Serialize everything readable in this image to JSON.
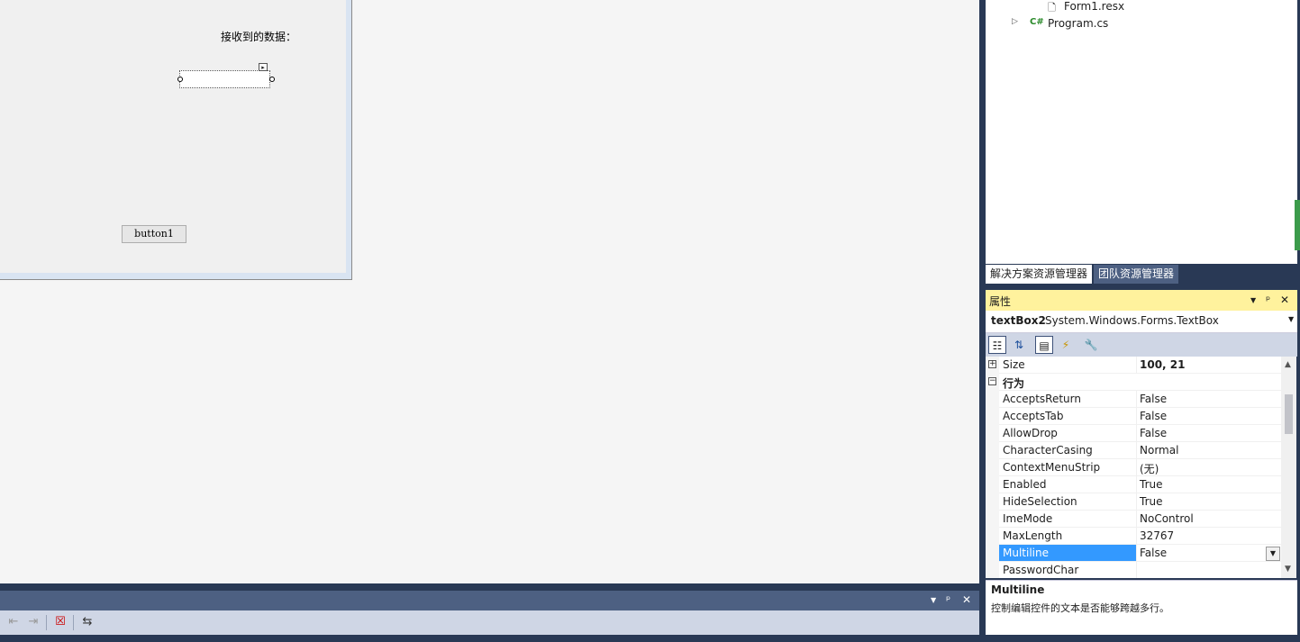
{
  "designer": {
    "label_text": "接收到的数据：",
    "button_text": "button1"
  },
  "solution_explorer": {
    "items": [
      {
        "name": "Form1.resx"
      },
      {
        "name": "Program.cs",
        "badge": "C#"
      }
    ],
    "tabs": [
      "解决方案资源管理器",
      "团队资源管理器"
    ]
  },
  "properties": {
    "title": "属性",
    "object_name": "textBox2",
    "object_type": "System.Windows.Forms.TextBox",
    "rows": [
      {
        "name": "Size",
        "value": "100, 21"
      },
      {
        "name": "行为",
        "value": ""
      },
      {
        "name": "AcceptsReturn",
        "value": "False"
      },
      {
        "name": "AcceptsTab",
        "value": "False"
      },
      {
        "name": "AllowDrop",
        "value": "False"
      },
      {
        "name": "CharacterCasing",
        "value": "Normal"
      },
      {
        "name": "ContextMenuStrip",
        "value": "(无)"
      },
      {
        "name": "Enabled",
        "value": "True"
      },
      {
        "name": "HideSelection",
        "value": "True"
      },
      {
        "name": "ImeMode",
        "value": "NoControl"
      },
      {
        "name": "MaxLength",
        "value": "32767"
      },
      {
        "name": "Multiline",
        "value": "False"
      },
      {
        "name": "PasswordChar",
        "value": ""
      }
    ],
    "description_title": "Multiline",
    "description_text": "控制编辑控件的文本是否能够跨越多行。"
  },
  "colors": {
    "dock_dark": "#293955",
    "dock_tab": "#4d6082",
    "props_title": "#fff29d",
    "selection": "#3399ff"
  }
}
